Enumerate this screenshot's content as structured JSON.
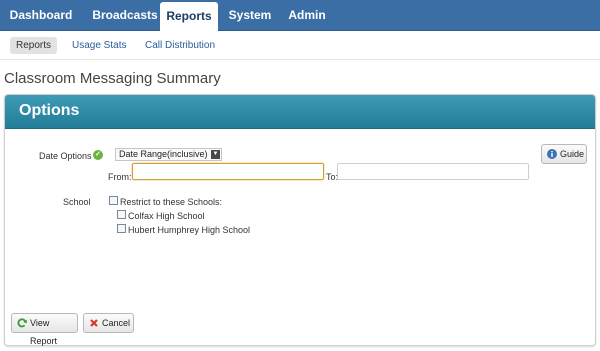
{
  "topnav": {
    "tabs": [
      "Dashboard",
      "Broadcasts",
      "Reports",
      "System",
      "Admin"
    ],
    "active": "Reports"
  },
  "subnav": {
    "items": [
      "Reports",
      "Usage Stats",
      "Call Distribution"
    ],
    "active": "Reports"
  },
  "page": {
    "title": "Classroom Messaging Summary"
  },
  "options": {
    "header": "Options",
    "date_options_label": "Date Options",
    "date_range_select": "Date Range(inclusive)",
    "from_label": "From:",
    "to_label": "To:",
    "from_value": "",
    "to_value": "",
    "guide_button": "Guide",
    "school_label": "School",
    "restrict_label": "Restrict to these Schools:",
    "schools": [
      "Colfax High School",
      "Hubert Humphrey High School"
    ]
  },
  "actions": {
    "view_report": "View Report",
    "cancel": "Cancel"
  },
  "colors": {
    "nav": "#3a6ea5",
    "panel_header": "#2e8ba6",
    "accent": "#d99a3c",
    "success": "#6cb33f",
    "cancel": "#d33a2c"
  },
  "icons": {
    "guide": "info-icon",
    "view": "refresh-icon",
    "cancel": "x-icon",
    "valid": "check-icon"
  }
}
